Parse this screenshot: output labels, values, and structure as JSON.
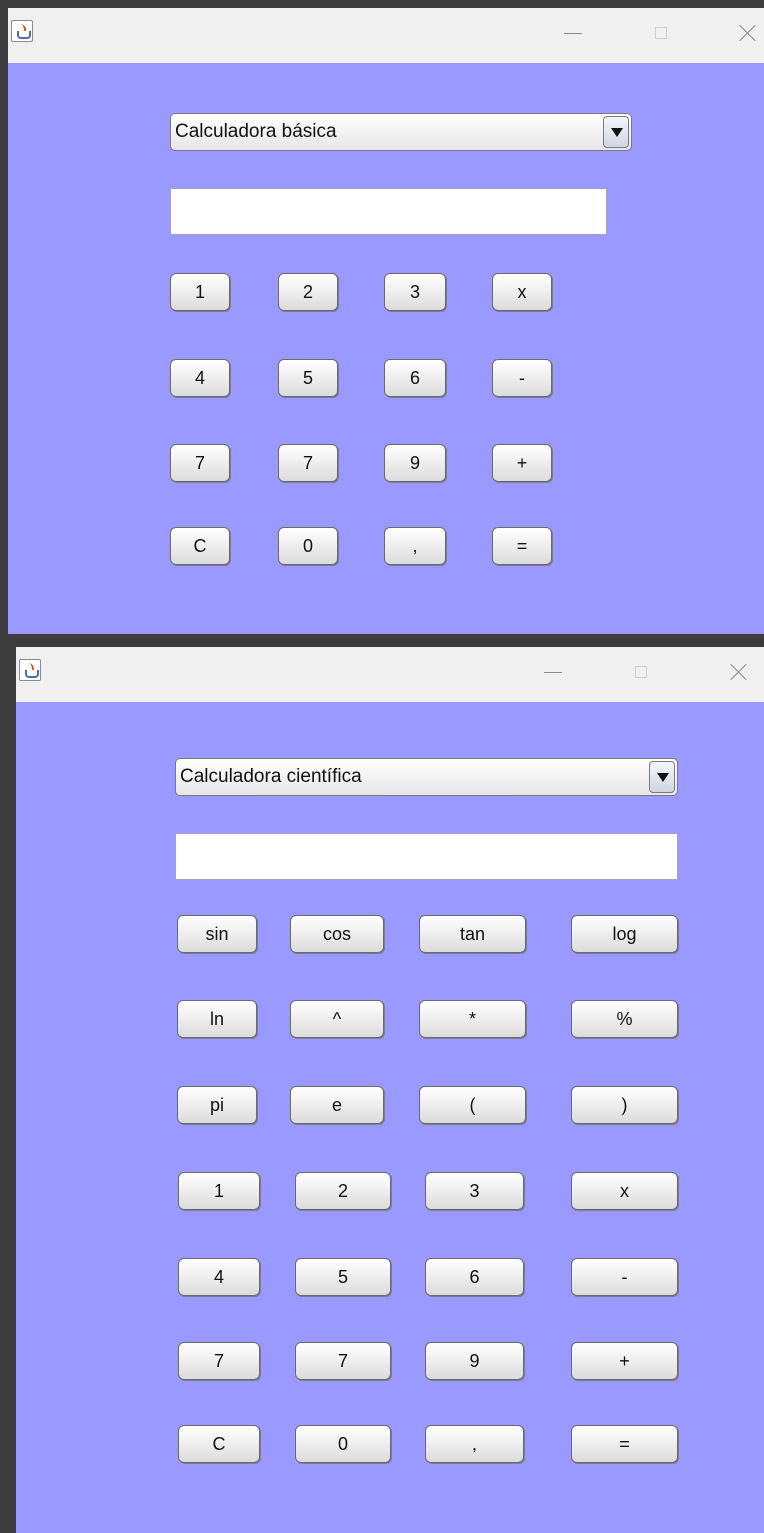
{
  "windows": [
    {
      "mode_selector": {
        "selected": "Calculadora básica"
      },
      "display": {
        "value": ""
      },
      "buttons": [
        {
          "label": "1"
        },
        {
          "label": "2"
        },
        {
          "label": "3"
        },
        {
          "label": "x"
        },
        {
          "label": "4"
        },
        {
          "label": "5"
        },
        {
          "label": "6"
        },
        {
          "label": "-"
        },
        {
          "label": "7"
        },
        {
          "label": "7"
        },
        {
          "label": "9"
        },
        {
          "label": "+"
        },
        {
          "label": "C"
        },
        {
          "label": "0"
        },
        {
          "label": ","
        },
        {
          "label": "="
        }
      ]
    },
    {
      "mode_selector": {
        "selected": "Calculadora científica"
      },
      "display": {
        "value": ""
      },
      "buttons": [
        {
          "label": "sin"
        },
        {
          "label": "cos"
        },
        {
          "label": "tan"
        },
        {
          "label": "log"
        },
        {
          "label": "ln"
        },
        {
          "label": "^"
        },
        {
          "label": "*"
        },
        {
          "label": "%"
        },
        {
          "label": "pi"
        },
        {
          "label": "e"
        },
        {
          "label": "("
        },
        {
          "label": ")"
        },
        {
          "label": "1"
        },
        {
          "label": "2"
        },
        {
          "label": "3"
        },
        {
          "label": "x"
        },
        {
          "label": "4"
        },
        {
          "label": "5"
        },
        {
          "label": "6"
        },
        {
          "label": "-"
        },
        {
          "label": "7"
        },
        {
          "label": "7"
        },
        {
          "label": "9"
        },
        {
          "label": "+"
        },
        {
          "label": "C"
        },
        {
          "label": "0"
        },
        {
          "label": ","
        },
        {
          "label": "="
        }
      ]
    }
  ],
  "colors": {
    "window_background": "#9999ff",
    "titlebar": "#f0f0f0",
    "desktop": "#3c3c3c"
  },
  "icons": {
    "app": "java-app-icon",
    "minimize": "minimize-icon",
    "maximize": "maximize-icon",
    "close": "close-icon"
  }
}
